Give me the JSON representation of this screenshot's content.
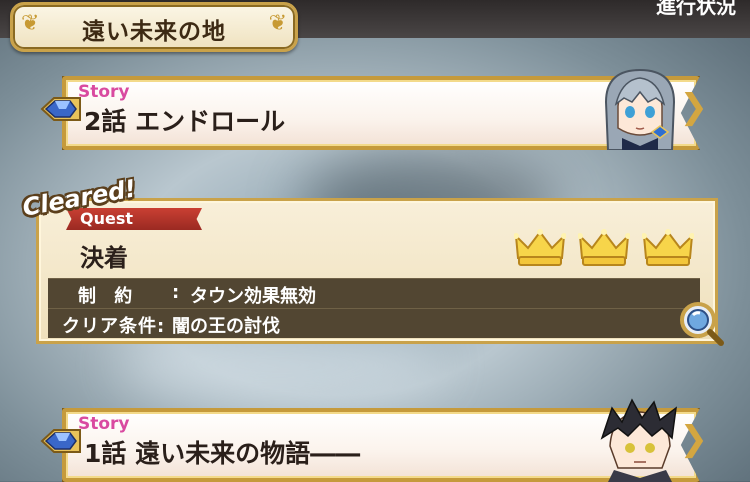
{
  "header": {
    "area_title": "遠い未来の地",
    "progress_label": "進行状況"
  },
  "stories": [
    {
      "tag": "Story",
      "title": "2話 エンドロール"
    },
    {
      "tag": "Story",
      "title": "1話 遠い未来の物語――"
    }
  ],
  "quest": {
    "cleared_label": "Cleared!",
    "tag": "Quest",
    "title": "決着",
    "crowns_earned": 3,
    "restriction_label": "制 約",
    "restriction_value": "タウン効果無効",
    "clear_condition_label": "クリア条件:",
    "clear_condition_value": "闇の王の討伐"
  },
  "colors": {
    "gold_frame": "#c9a24a",
    "story_tag": "#d94aa0",
    "quest_tag": "#c94033",
    "info_row": "#524632"
  }
}
